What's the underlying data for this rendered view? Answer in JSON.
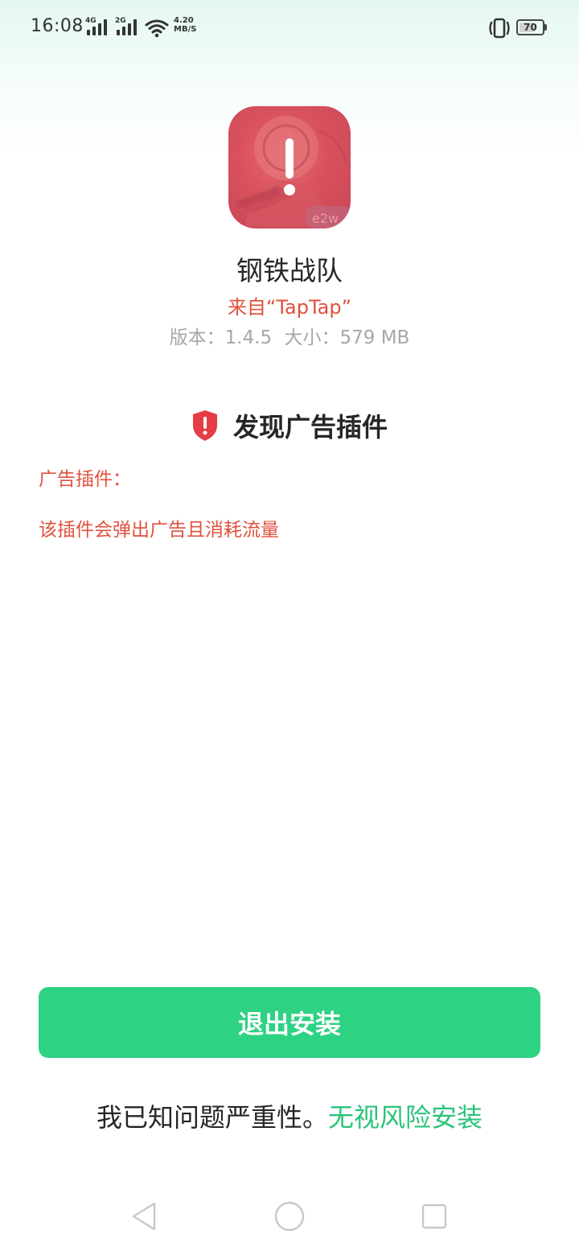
{
  "status_bar": {
    "time": "16:08",
    "signal1_label": "4G",
    "signal2_label": "2G",
    "net_speed_value": "4.20",
    "net_speed_unit": "MB/S",
    "battery_level": "70",
    "icons": [
      "signal-icon",
      "signal-icon",
      "wifi-icon",
      "vibrate-icon",
      "battery-icon"
    ]
  },
  "app": {
    "icon": "app-icon",
    "name": "钢铁战队",
    "source": "来自“TapTap”",
    "version": "版本：1.4.5",
    "size": "大小：579 MB"
  },
  "warning": {
    "icon": "shield-alert-icon",
    "title": "发现广告插件",
    "plugin_label": "广告插件：",
    "plugin_description": "该插件会弹出广告且消耗流量"
  },
  "actions": {
    "exit_label": "退出安装",
    "acknowledge_text": "我已知问题严重性。",
    "ignore_risk_label": "无视风险安装"
  },
  "nav_bar": {
    "back_icon": "back-icon",
    "home_icon": "home-icon",
    "recents_icon": "recents-icon"
  },
  "colors": {
    "accent_green": "#2dd283",
    "link_green": "#2bc37a",
    "warning_red": "#e0513e",
    "shield_red": "#e53c46",
    "muted_gray": "#a7a7a7"
  }
}
